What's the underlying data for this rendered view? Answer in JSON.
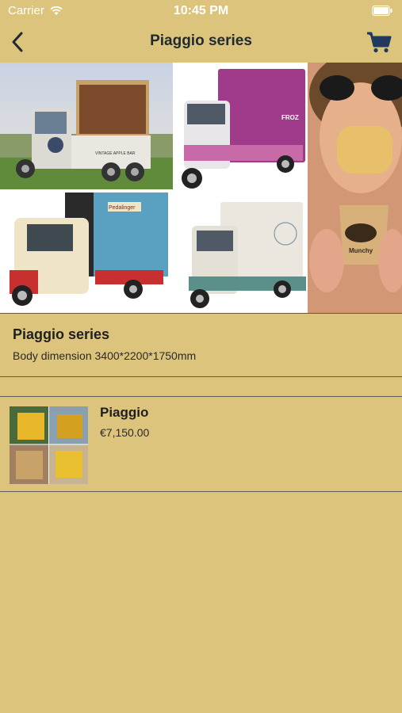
{
  "status_bar": {
    "carrier": "Carrier",
    "time": "10:45 PM"
  },
  "nav": {
    "title": "Piaggio series",
    "back_icon": "chevron-left-icon",
    "cart_icon": "cart-icon"
  },
  "hero": {
    "vehicle_labels": [
      "VINTAGE APPLE BAR",
      "FROZ",
      "Pedalinger",
      "Munchy"
    ]
  },
  "series_info": {
    "title": "Piaggio series",
    "description": "Body dimension 3400*2200*1750mm"
  },
  "products": [
    {
      "name": "Piaggio",
      "price": "€7,150.00"
    }
  ],
  "colors": {
    "background": "#dcc47c",
    "nav_title": "#1f2a33",
    "divider": "#5e5a52"
  }
}
